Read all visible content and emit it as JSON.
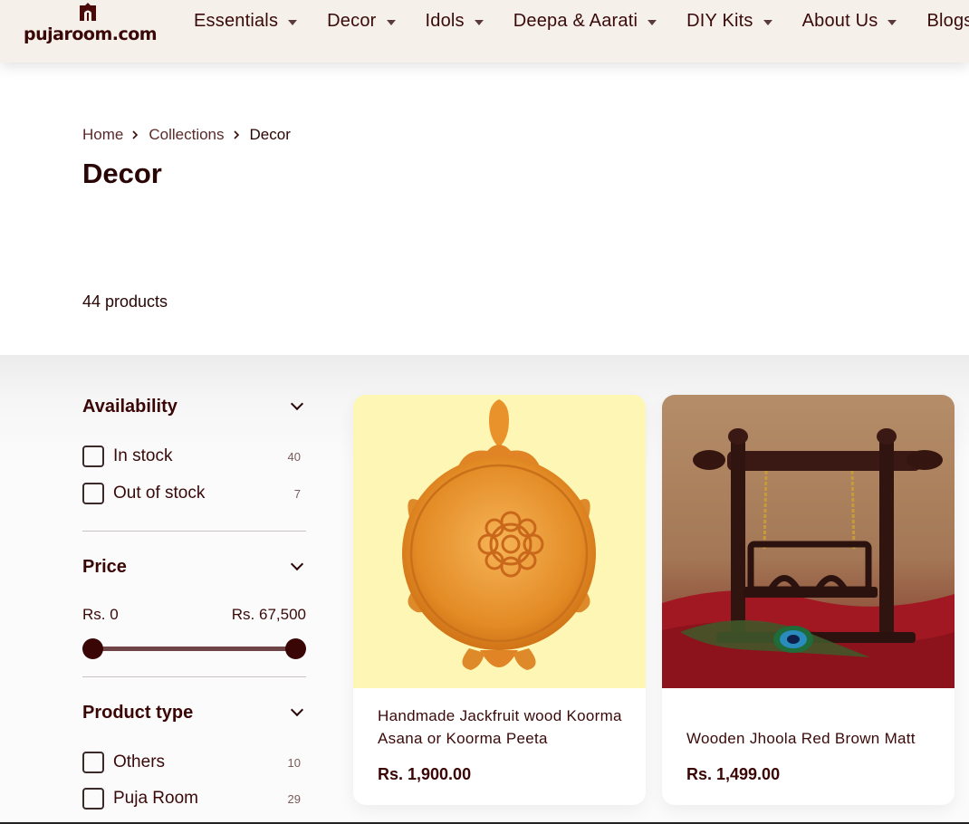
{
  "header": {
    "logo_text": "pujaroom.com",
    "nav": [
      {
        "label": "Essentials"
      },
      {
        "label": "Decor"
      },
      {
        "label": "Idols"
      },
      {
        "label": "Deepa & Aarati"
      },
      {
        "label": "DIY Kits"
      },
      {
        "label": "About Us"
      },
      {
        "label": "Blogs"
      }
    ]
  },
  "breadcrumb": {
    "home": "Home",
    "collections": "Collections",
    "current": "Decor"
  },
  "page": {
    "title": "Decor",
    "product_count": "44 products"
  },
  "filters": {
    "availability": {
      "label": "Availability",
      "options": [
        {
          "label": "In stock",
          "count": "40"
        },
        {
          "label": "Out of stock",
          "count": "7"
        }
      ]
    },
    "price": {
      "label": "Price",
      "min": "Rs. 0",
      "max": "Rs. 67,500",
      "range": [
        0,
        1
      ]
    },
    "product_type": {
      "label": "Product type",
      "options": [
        {
          "label": "Others",
          "count": "10"
        },
        {
          "label": "Puja Room",
          "count": "29"
        }
      ]
    }
  },
  "products": [
    {
      "title": "Handmade Jackfruit wood Koorma Asana or Koorma Peeta",
      "price": "Rs. 1,900.00"
    },
    {
      "title": "Wooden Jhoola Red Brown Matt",
      "price": "Rs. 1,499.00"
    }
  ],
  "colors": {
    "accent": "#3a0505",
    "header_bg": "#f5f1ea",
    "slider": "#6e4446"
  }
}
